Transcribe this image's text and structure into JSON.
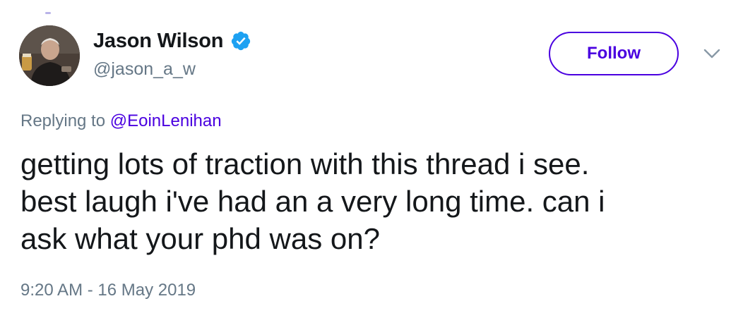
{
  "author": {
    "display_name": "Jason Wilson",
    "handle": "@jason_a_w",
    "verified": true,
    "avatar_icon": "user-photo-avatar"
  },
  "actions": {
    "follow_label": "Follow",
    "more_icon": "chevron-down-icon"
  },
  "reply": {
    "prefix": "Replying to",
    "mention": "@EoinLenihan"
  },
  "tweet": {
    "text": "getting lots of traction with this thread i see.\nbest laugh i've had an a very long time. can i\nask what your phd was on?",
    "timestamp": "9:20 AM - 16 May 2019"
  },
  "colors": {
    "accent": "#4a00e0",
    "verified_badge": "#1da1f2",
    "muted_text": "#657786",
    "primary_text": "#14171a"
  }
}
